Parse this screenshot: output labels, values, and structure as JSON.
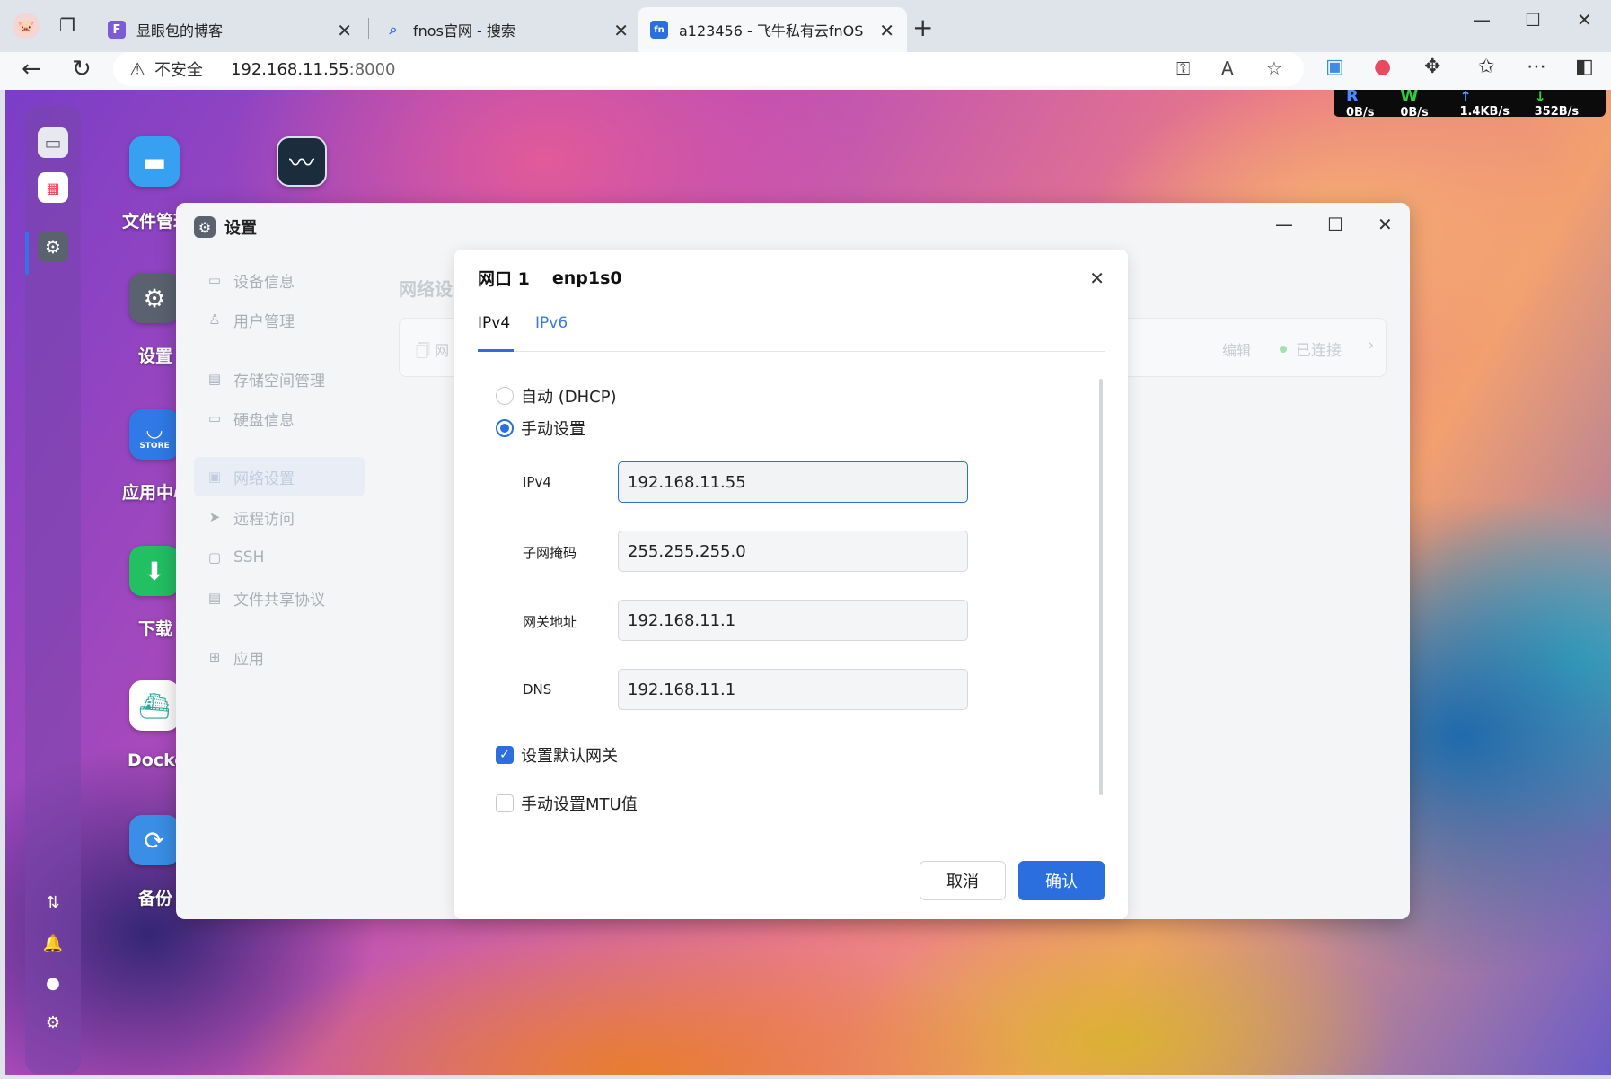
{
  "browser": {
    "tabs": [
      {
        "title": "显眼包的博客",
        "favicon": "F"
      },
      {
        "title": "fnos官网 - 搜索",
        "favicon": "search"
      },
      {
        "title": "a123456 - 飞牛私有云fnOS",
        "favicon": "fn"
      }
    ],
    "address": {
      "security_label": "不安全",
      "host": "192.168.11.55",
      "port": ":8000"
    }
  },
  "netmon": {
    "r_label": "R",
    "r_value": "0B/s",
    "w_label": "W",
    "w_value": "0B/s",
    "up_value": "1.4KB/s",
    "down_value": "352B/s"
  },
  "desktop": {
    "apps": [
      {
        "label": "文件管理"
      },
      {
        "label": "设置"
      },
      {
        "label": "应用中心",
        "badge": "STORE"
      },
      {
        "label": "下载"
      },
      {
        "label": "Docker"
      },
      {
        "label": "备份"
      }
    ]
  },
  "settings": {
    "title": "设置",
    "sidebar": [
      {
        "label": "设备信息",
        "icon": "device-icon"
      },
      {
        "label": "用户管理",
        "icon": "user-icon"
      },
      {
        "label": "存储空间管理",
        "icon": "storage-icon"
      },
      {
        "label": "硬盘信息",
        "icon": "disk-icon"
      },
      {
        "label": "网络设置",
        "icon": "network-icon"
      },
      {
        "label": "远程访问",
        "icon": "send-icon"
      },
      {
        "label": "SSH",
        "icon": "terminal-icon"
      },
      {
        "label": "文件共享协议",
        "icon": "file-icon"
      },
      {
        "label": "应用",
        "icon": "apps-icon"
      }
    ],
    "content_title": "网络设",
    "card": {
      "label": "网",
      "edit": "编辑",
      "status": "已连接"
    }
  },
  "dialog": {
    "title": "网口 1",
    "interface": "enp1s0",
    "tabs": [
      "IPv4",
      "IPv6"
    ],
    "radio_auto": "自动 (DHCP)",
    "radio_manual": "手动设置",
    "fields": [
      {
        "label": "IPv4",
        "value": "192.168.11.55"
      },
      {
        "label": "子网掩码",
        "value": "255.255.255.0"
      },
      {
        "label": "网关地址",
        "value": "192.168.11.1"
      },
      {
        "label": "DNS",
        "value": "192.168.11.1"
      }
    ],
    "check_default_gateway": "设置默认网关",
    "check_mtu": "手动设置MTU值",
    "cancel": "取消",
    "confirm": "确认"
  },
  "colors": {
    "accent": "#2b6fde",
    "netmon_bg": "#0b0b0b"
  }
}
